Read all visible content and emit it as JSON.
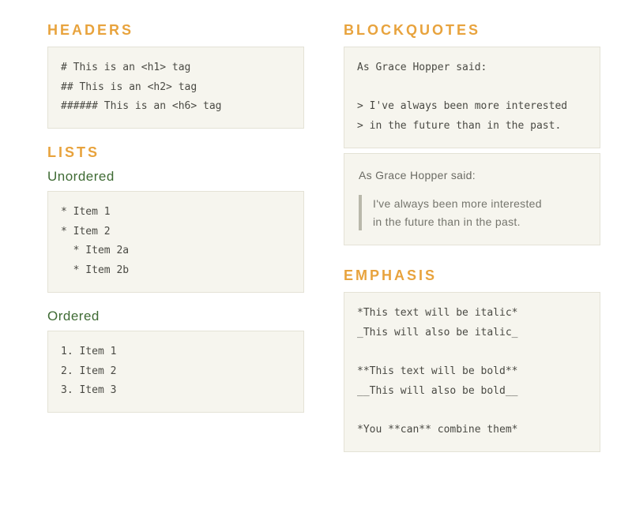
{
  "left": {
    "headers": {
      "title": "HEADERS",
      "code": "# This is an <h1> tag\n## This is an <h2> tag\n###### This is an <h6> tag"
    },
    "lists": {
      "title": "LISTS",
      "unordered_label": "Unordered",
      "unordered_code": "* Item 1\n* Item 2\n  * Item 2a\n  * Item 2b",
      "ordered_label": "Ordered",
      "ordered_code": "1. Item 1\n2. Item 2\n3. Item 3"
    }
  },
  "right": {
    "blockquotes": {
      "title": "BLOCKQUOTES",
      "code": "As Grace Hopper said:\n\n> I've always been more interested\n> in the future than in the past.",
      "rendered_intro": "As Grace Hopper said:",
      "rendered_quote_line1": "I've always been more interested",
      "rendered_quote_line2": "in the future than in the past."
    },
    "emphasis": {
      "title": "EMPHASIS",
      "code": "*This text will be italic*\n_This will also be italic_\n\n**This text will be bold**\n__This will also be bold__\n\n*You **can** combine them*"
    }
  }
}
